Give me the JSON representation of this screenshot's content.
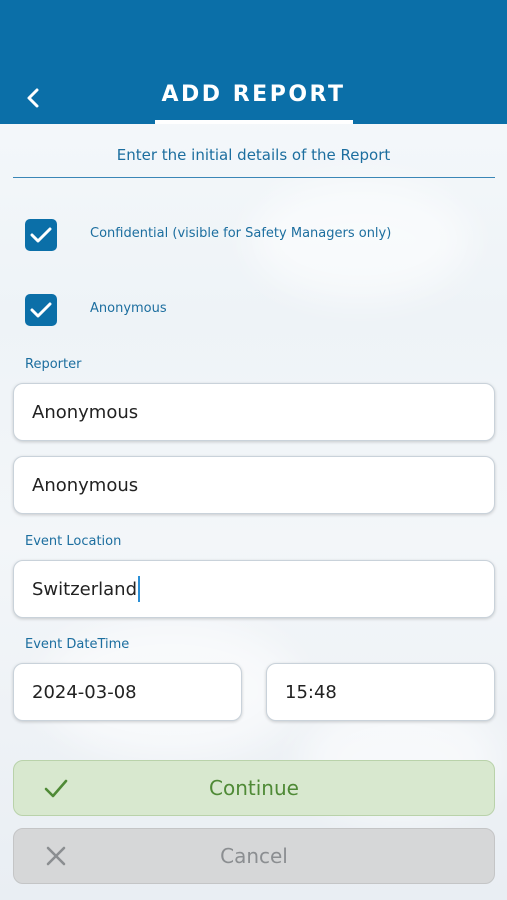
{
  "header": {
    "title": "ADD REPORT",
    "background_color": "#0b6fa8",
    "back_icon": "chevron-left-icon"
  },
  "intro": {
    "text": "Enter the initial details of the Report"
  },
  "options": [
    {
      "label": "Confidential (visible for Safety Managers only)",
      "checked": true
    },
    {
      "label": "Anonymous",
      "checked": true
    }
  ],
  "reporter": {
    "label": "Reporter",
    "first_value": "Anonymous",
    "second_value": "Anonymous"
  },
  "event_location": {
    "label": "Event Location",
    "value": "Switzerland"
  },
  "event_datetime": {
    "label": "Event DateTime",
    "date": "2024-03-08",
    "time": "15:48"
  },
  "actions": {
    "continue_label": "Continue",
    "continue_icon": "checkmark-icon",
    "cancel_label": "Cancel",
    "cancel_icon": "close-icon"
  }
}
